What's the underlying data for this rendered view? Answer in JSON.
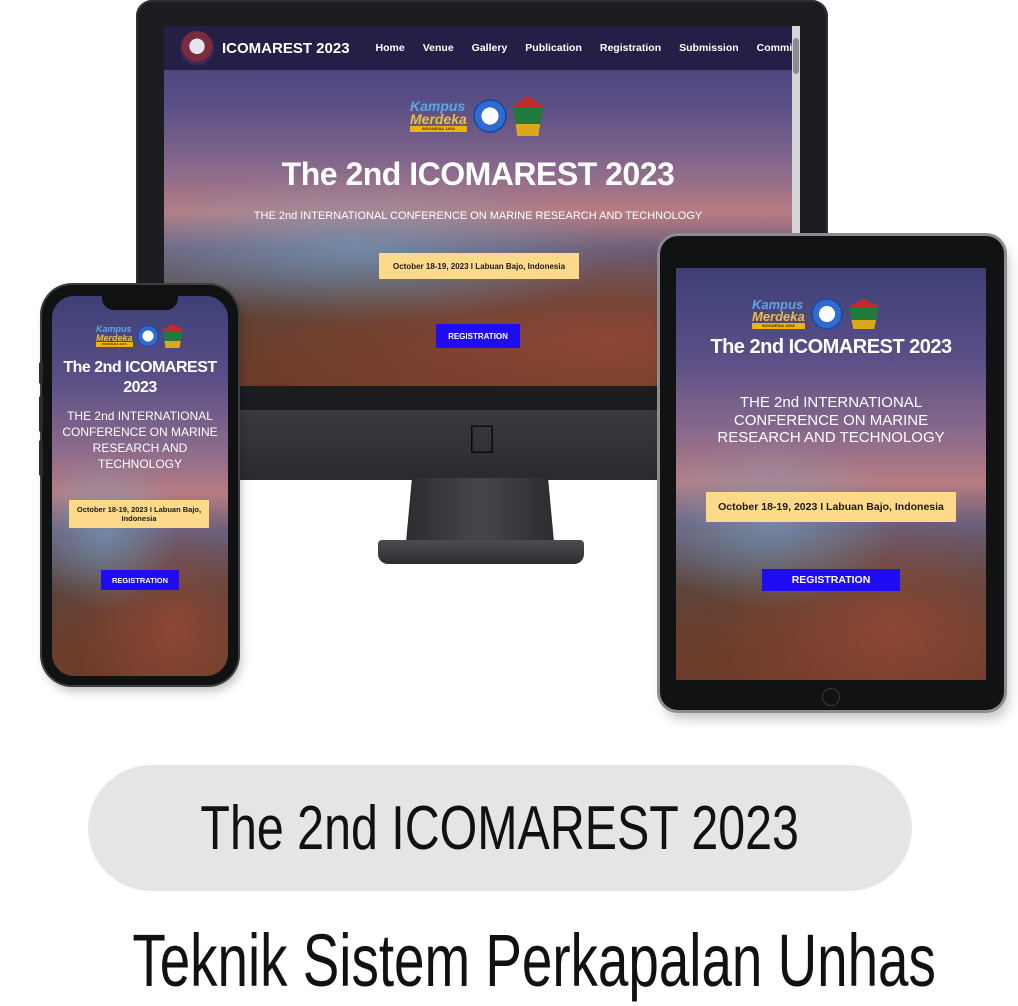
{
  "desktop": {
    "site_title": "ICOMAREST 2023",
    "nav": [
      "Home",
      "Venue",
      "Gallery",
      "Publication",
      "Registration",
      "Submission",
      "Committee"
    ],
    "hero_title": "The 2nd ICOMAREST 2023",
    "hero_subtitle": "THE 2nd INTERNATIONAL CONFERENCE ON MARINE RESEARCH AND TECHNOLOGY",
    "date": "October 18-19, 2023 I Labuan Bajo, Indonesia",
    "registration_button": "REGISTRATION"
  },
  "tablet": {
    "hero_title": "The 2nd ICOMAREST 2023",
    "hero_subtitle": "THE 2nd INTERNATIONAL CONFERENCE ON MARINE RESEARCH AND TECHNOLOGY",
    "date": "October 18-19, 2023 I Labuan Bajo, Indonesia",
    "registration_button": "REGISTRATION"
  },
  "phone": {
    "hero_title": "The 2nd ICOMAREST 2023",
    "hero_subtitle": "THE 2nd INTERNATIONAL CONFERENCE ON MARINE RESEARCH AND TECHNOLOGY",
    "date": "October 18-19, 2023 I Labuan Bajo, Indonesia",
    "registration_button": "REGISTRATION"
  },
  "logos": {
    "kampus_line1": "Kampus",
    "kampus_line2": "Merdeka",
    "kampus_tag": "INDONESIA JAYA"
  },
  "caption": {
    "title": "The 2nd ICOMAREST 2023",
    "subtitle": "Teknik Sistem Perkapalan Unhas"
  },
  "colors": {
    "nav_bg": "#241f47",
    "date_box": "#fdd98a",
    "registration_button": "#1f0cf2",
    "caption_pill": "#e5e5e5"
  }
}
